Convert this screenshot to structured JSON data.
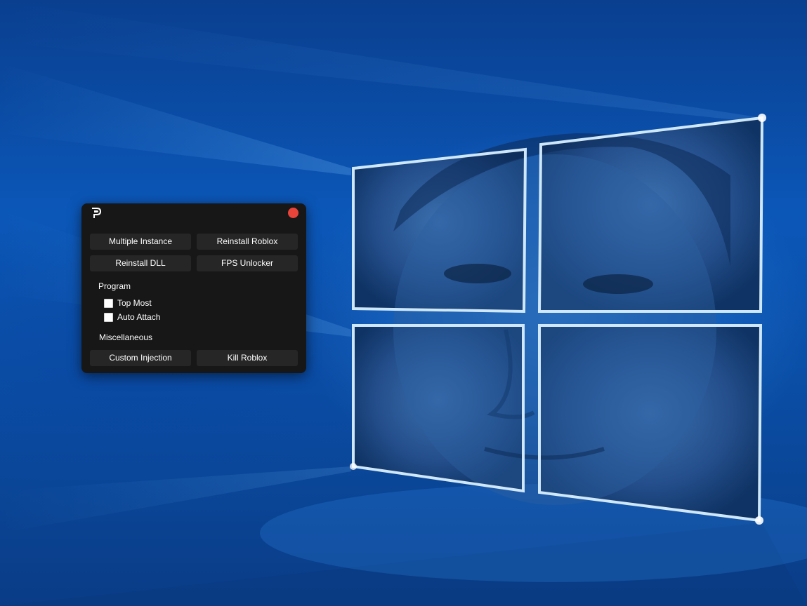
{
  "app": {
    "logo_icon": "p-logo-icon",
    "close_icon": "close-circle-icon",
    "close_color": "#e8443a",
    "window_color": "#171717",
    "button_color": "#262626"
  },
  "buttons": {
    "multiple_instance": "Multiple Instance",
    "reinstall_roblox": "Reinstall Roblox",
    "reinstall_dll": "Reinstall DLL",
    "fps_unlocker": "FPS Unlocker",
    "custom_injection": "Custom Injection",
    "kill_roblox": "Kill Roblox"
  },
  "program": {
    "label": "Program",
    "options": [
      {
        "label": "Top Most",
        "checked": false
      },
      {
        "label": "Auto Attach",
        "checked": false
      }
    ]
  },
  "misc": {
    "label": "Miscellaneous"
  },
  "desktop": {
    "wallpaper": "windows-10-hero-wallpaper-with-face-overlay",
    "accent": "#0b57b8"
  }
}
